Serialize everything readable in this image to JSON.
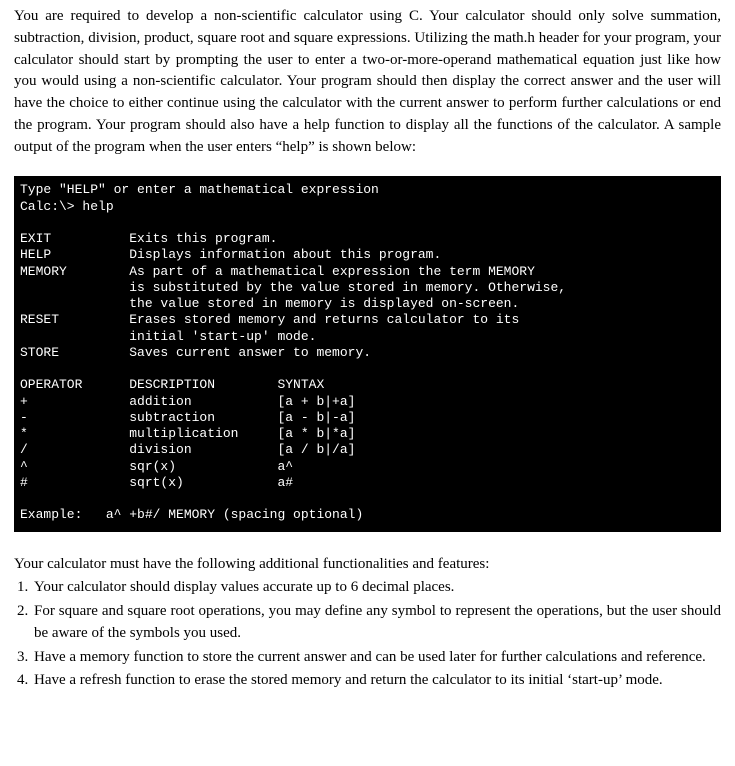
{
  "intro": "You are required to develop a non-scientific calculator using C. Your calculator should only solve summation, subtraction, division, product, square root and square expressions. Utilizing the math.h header for your program, your calculator should start by prompting the user to enter a two-or-more-operand mathematical equation just like how you would using a non-scientific calculator. Your program should then display the correct answer and the user will have the choice to either continue using the calculator with the current answer to perform further calculations or end the program. Your program should also have a help function to display all the functions of the calculator. A sample output of the program when the user enters “help” is shown below:",
  "console": "Type \"HELP\" or enter a mathematical expression\nCalc:\\> help\n\nEXIT          Exits this program.\nHELP          Displays information about this program.\nMEMORY        As part of a mathematical expression the term MEMORY\n              is substituted by the value stored in memory. Otherwise,\n              the value stored in memory is displayed on-screen.\nRESET         Erases stored memory and returns calculator to its\n              initial 'start-up' mode.\nSTORE         Saves current answer to memory.\n\nOPERATOR      DESCRIPTION        SYNTAX\n+             addition           [a + b|+a]\n-             subtraction        [a - b|-a]\n*             multiplication     [a * b|*a]\n/             division           [a / b|/a]\n^             sqr(x)             a^\n#             sqrt(x)            a#\n\nExample:   a^ +b#/ MEMORY (spacing optional)",
  "features_intro": "Your calculator must have the following additional functionalities and features:",
  "features": {
    "f1": "Your calculator should display values accurate up to 6 decimal places.",
    "f2": "For square and square root operations, you may define any symbol to represent the operations, but the user should be aware of the symbols you used.",
    "f3": "Have a memory function to store the current answer and can be used later for further calculations and reference.",
    "f4": "Have a refresh function to erase the stored memory and return the calculator to its initial ‘start-up’ mode."
  }
}
